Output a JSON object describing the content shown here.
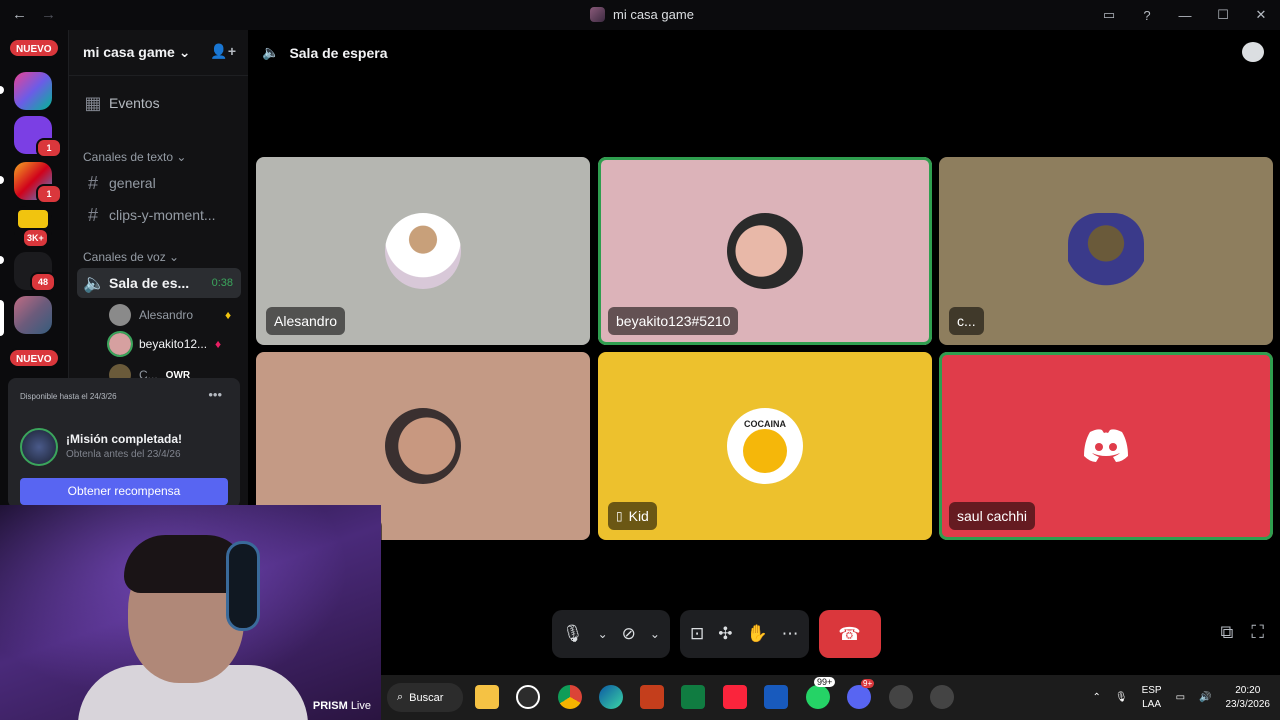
{
  "window": {
    "title": "mi casa game",
    "nav_back": "←",
    "nav_forward": "→",
    "controls": [
      "▭",
      "?",
      "—",
      "☐",
      "✕"
    ]
  },
  "servers": {
    "new_badge_top": "NUEVO",
    "new_badge_bottom": "NUEVO",
    "counts": [
      "1",
      "1",
      "3K+",
      "48",
      "1"
    ]
  },
  "guild": {
    "name": "mi casa game ⌄",
    "events": "Eventos",
    "text_category": "Canales de texto ⌄",
    "text_channels": [
      "general",
      "clips-y-moment..."
    ],
    "voice_category": "Canales de voz ⌄",
    "voice_channel": {
      "name": "Sala de es...",
      "timer": "0:38"
    },
    "voice_users": [
      {
        "name": "Alesandro"
      },
      {
        "name": "beyakito12..."
      },
      {
        "name": "C...",
        "tag": "OWR"
      }
    ]
  },
  "quest": {
    "available": "Disponible hasta el 24/3/26",
    "title": "¡Misión completada!",
    "subtitle": "Obtenla antes del 23/4/26",
    "button": "Obtener recompensa"
  },
  "stage": {
    "channel_name": "Sala de espera",
    "tiles": [
      {
        "name": "Alesandro",
        "bg": "#b5b6b1",
        "active": false
      },
      {
        "name": "beyakito123#5210",
        "bg": "#dcb3b9",
        "active": true
      },
      {
        "name": "c...",
        "bg": "#8e7e5e",
        "active": false
      },
      {
        "name": "",
        "bg": "#c49a85",
        "active": false
      },
      {
        "name": "Kid",
        "bg": "#edc12d",
        "active": false,
        "mobile": true,
        "avatar_text": "COCAINA"
      },
      {
        "name": "saul cachhi",
        "bg": "#e03c4a",
        "active": true
      }
    ]
  },
  "webcam": {
    "brand": "PRISM",
    "suffix": "Live"
  },
  "taskbar": {
    "search": "Buscar",
    "whatsapp_badge": "99+",
    "discord_badge": "9+",
    "lang_top": "ESP",
    "lang_bottom": "LAA",
    "time": "20:20",
    "date": "23/3/2026"
  }
}
